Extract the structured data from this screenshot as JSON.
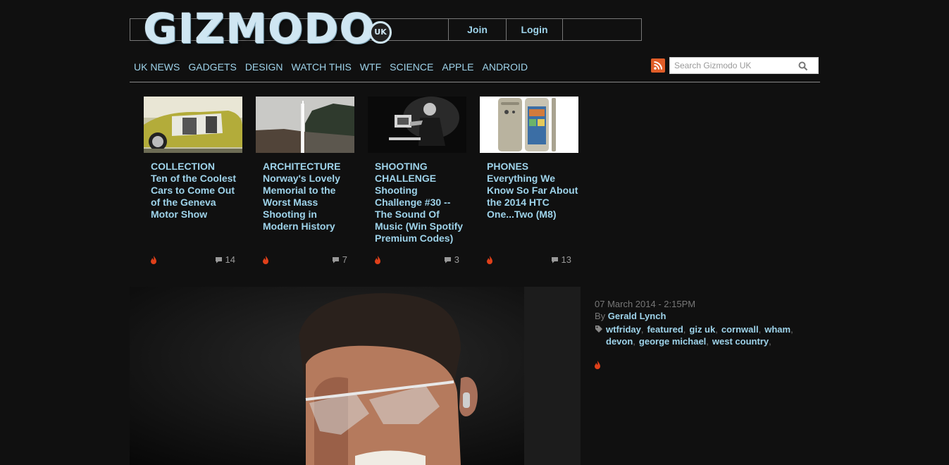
{
  "header": {
    "logo_text": "GIZMODO",
    "logo_badge": "UK",
    "join_label": "Join",
    "login_label": "Login"
  },
  "nav": {
    "items": [
      "UK NEWS",
      "GADGETS",
      "DESIGN",
      "WATCH THIS",
      "WTF",
      "SCIENCE",
      "APPLE",
      "ANDROID"
    ]
  },
  "search": {
    "placeholder": "Search Gizmodo UK",
    "value": ""
  },
  "featured": [
    {
      "category": "COLLECTION",
      "title": "Ten of the Coolest Cars to Come Out of the Geneva Motor Show",
      "comments": "14"
    },
    {
      "category": "ARCHITECTURE",
      "title": "Norway's Lovely Memorial to the Worst Mass Shooting in Modern History",
      "comments": "7"
    },
    {
      "category": "SHOOTING CHALLENGE",
      "title": "Shooting Challenge #30 -- The Sound Of Music (Win Spotify Premium Codes)",
      "comments": "3"
    },
    {
      "category": "PHONES",
      "title": "Everything We Know So Far About the 2014 HTC One...Two (M8)",
      "comments": "13"
    }
  ],
  "article": {
    "date": "07 March 2014 - 2:15PM",
    "by_label": "By",
    "author": "Gerald Lynch",
    "tags": [
      "wtfriday",
      "featured",
      "giz uk",
      "cornwall",
      "wham",
      "devon",
      "george michael",
      "west country"
    ]
  },
  "colors": {
    "background": "#101010",
    "link": "#9ed3ea",
    "rss": "#e05d28",
    "flame": "#e0401a"
  }
}
